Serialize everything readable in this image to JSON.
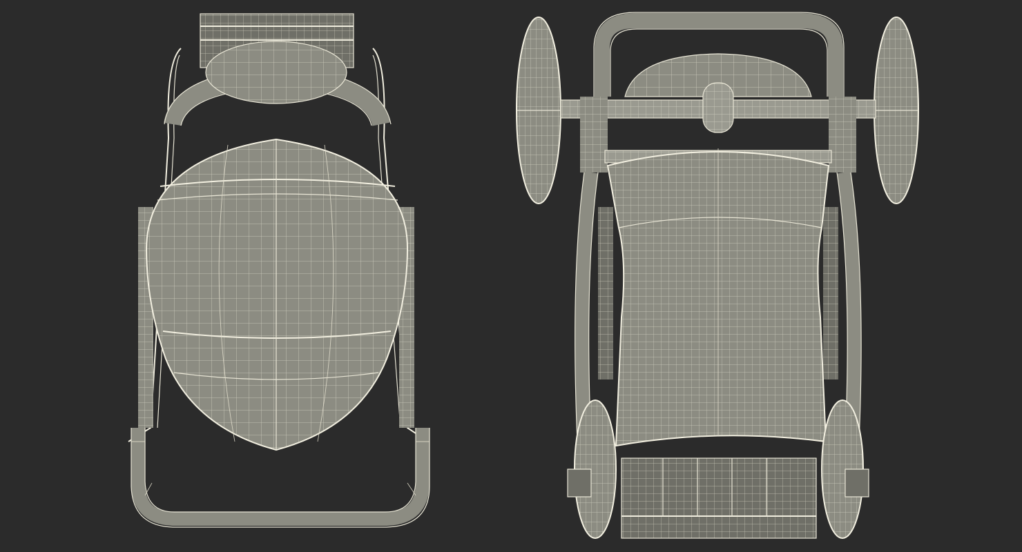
{
  "scene": {
    "background_color": "#2b2b2b",
    "mesh_color": "#8c8c82",
    "wire_color": "#e4e0cf",
    "views": [
      {
        "name": "top-view",
        "subject": "stroller-wireframe"
      },
      {
        "name": "bottom-view",
        "subject": "stroller-wireframe"
      }
    ]
  }
}
